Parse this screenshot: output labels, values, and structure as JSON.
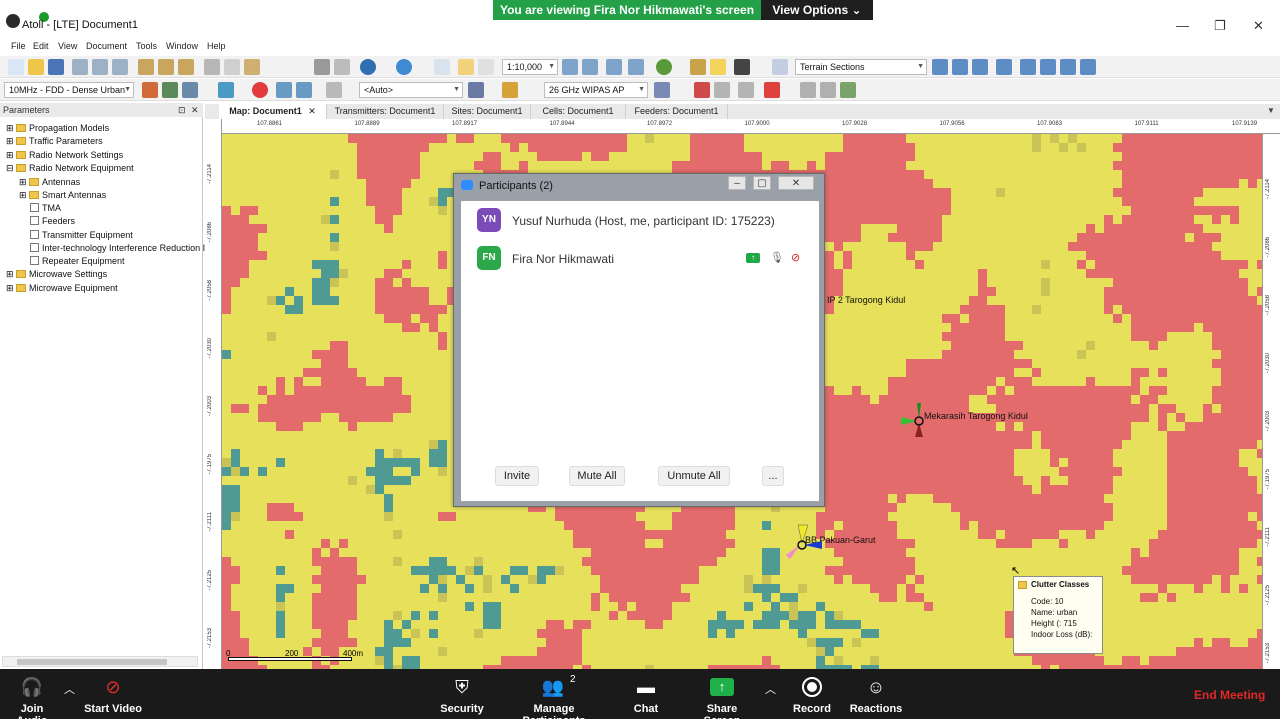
{
  "window": {
    "title": "Atoll - [LTE] Document1",
    "minimize": "—",
    "restore": "❐",
    "close": "✕"
  },
  "share_banner": {
    "text": "You are viewing Fira Nor Hikmawati's screen",
    "view_options": "View Options"
  },
  "menu": [
    "File",
    "Edit",
    "View",
    "Document",
    "Tools",
    "Window",
    "Help"
  ],
  "toolbar": {
    "scale": "1:10,000",
    "terrain": "Terrain Sections",
    "band": "10MHz - FDD - Dense Urban",
    "auto": "<Auto>",
    "wipas": "26 GHz WIPAS AP"
  },
  "left_panel": {
    "title": "Parameters",
    "items": [
      {
        "label": "Propagation Models",
        "level": 0,
        "type": "folder"
      },
      {
        "label": "Traffic Parameters",
        "level": 0,
        "type": "folder"
      },
      {
        "label": "Radio Network Settings",
        "level": 0,
        "type": "folder"
      },
      {
        "label": "Radio Network Equipment",
        "level": 0,
        "type": "folder"
      },
      {
        "label": "Antennas",
        "level": 1,
        "type": "folder"
      },
      {
        "label": "Smart Antennas",
        "level": 1,
        "type": "folder"
      },
      {
        "label": "TMA",
        "level": 1,
        "type": "leaf"
      },
      {
        "label": "Feeders",
        "level": 1,
        "type": "leaf"
      },
      {
        "label": "Transmitter Equipment",
        "level": 1,
        "type": "leaf"
      },
      {
        "label": "Inter-technology Interference Reduction I",
        "level": 1,
        "type": "leaf"
      },
      {
        "label": "Repeater Equipment",
        "level": 1,
        "type": "leaf"
      },
      {
        "label": "Microwave Settings",
        "level": 0,
        "type": "folder"
      },
      {
        "label": "Microwave Equipment",
        "level": 0,
        "type": "folder"
      }
    ]
  },
  "tabs": [
    "Map: Document1",
    "Transmitters: Document1",
    "Sites: Document1",
    "Cells: Document1",
    "Feeders: Document1"
  ],
  "ruler": {
    "top": [
      "107.8861",
      "107.8889",
      "107.8917",
      "107.8944",
      "107.8972",
      "107.9000",
      "107.9028",
      "107.9056",
      "107.9083",
      "107.9111",
      "107.9139"
    ],
    "left": [
      "-7.2114",
      "-7.2086",
      "-7.2058",
      "-7.2030",
      "-7.2003",
      "-7.1975",
      "-7.2111",
      "-7.2125",
      "-7.2153"
    ],
    "right": [
      "-7.2114",
      "-7.2086",
      "-7.2058",
      "-7.2030",
      "-7.2003",
      "-7.1975",
      "-7.2111",
      "-7.2125",
      "-7.2153"
    ]
  },
  "map": {
    "site_labels": [
      "IP 2 Tarogong Kidul",
      "Mekarasih Tarogong Kidul",
      "BB Pakuan-Garut"
    ],
    "scale_labels": [
      "0",
      "200",
      "400m"
    ]
  },
  "participants": {
    "title": "Participants (2)",
    "people": [
      {
        "initials": "YN",
        "name": "Yusuf Nurhuda (Host, me, participant ID: 175223)",
        "color": "#7b4bb7"
      },
      {
        "initials": "FN",
        "name": "Fira Nor Hikmawati",
        "color": "#2aa84a"
      }
    ],
    "buttons": [
      "Invite",
      "Mute All",
      "Unmute All",
      "..."
    ]
  },
  "tooltip": {
    "title": "Clutter Classes",
    "lines": [
      "Code: 10",
      "Name: urban",
      "Height (: 715",
      "Indoor Loss (dB):"
    ]
  },
  "zoom_bar": {
    "join_audio": "Join Audio",
    "start_video": "Start Video",
    "security": "Security",
    "manage_participants": "Manage Participants",
    "participant_count": "2",
    "chat": "Chat",
    "share_screen": "Share Screen",
    "record": "Record",
    "reactions": "Reactions",
    "end_meeting": "End Meeting"
  }
}
